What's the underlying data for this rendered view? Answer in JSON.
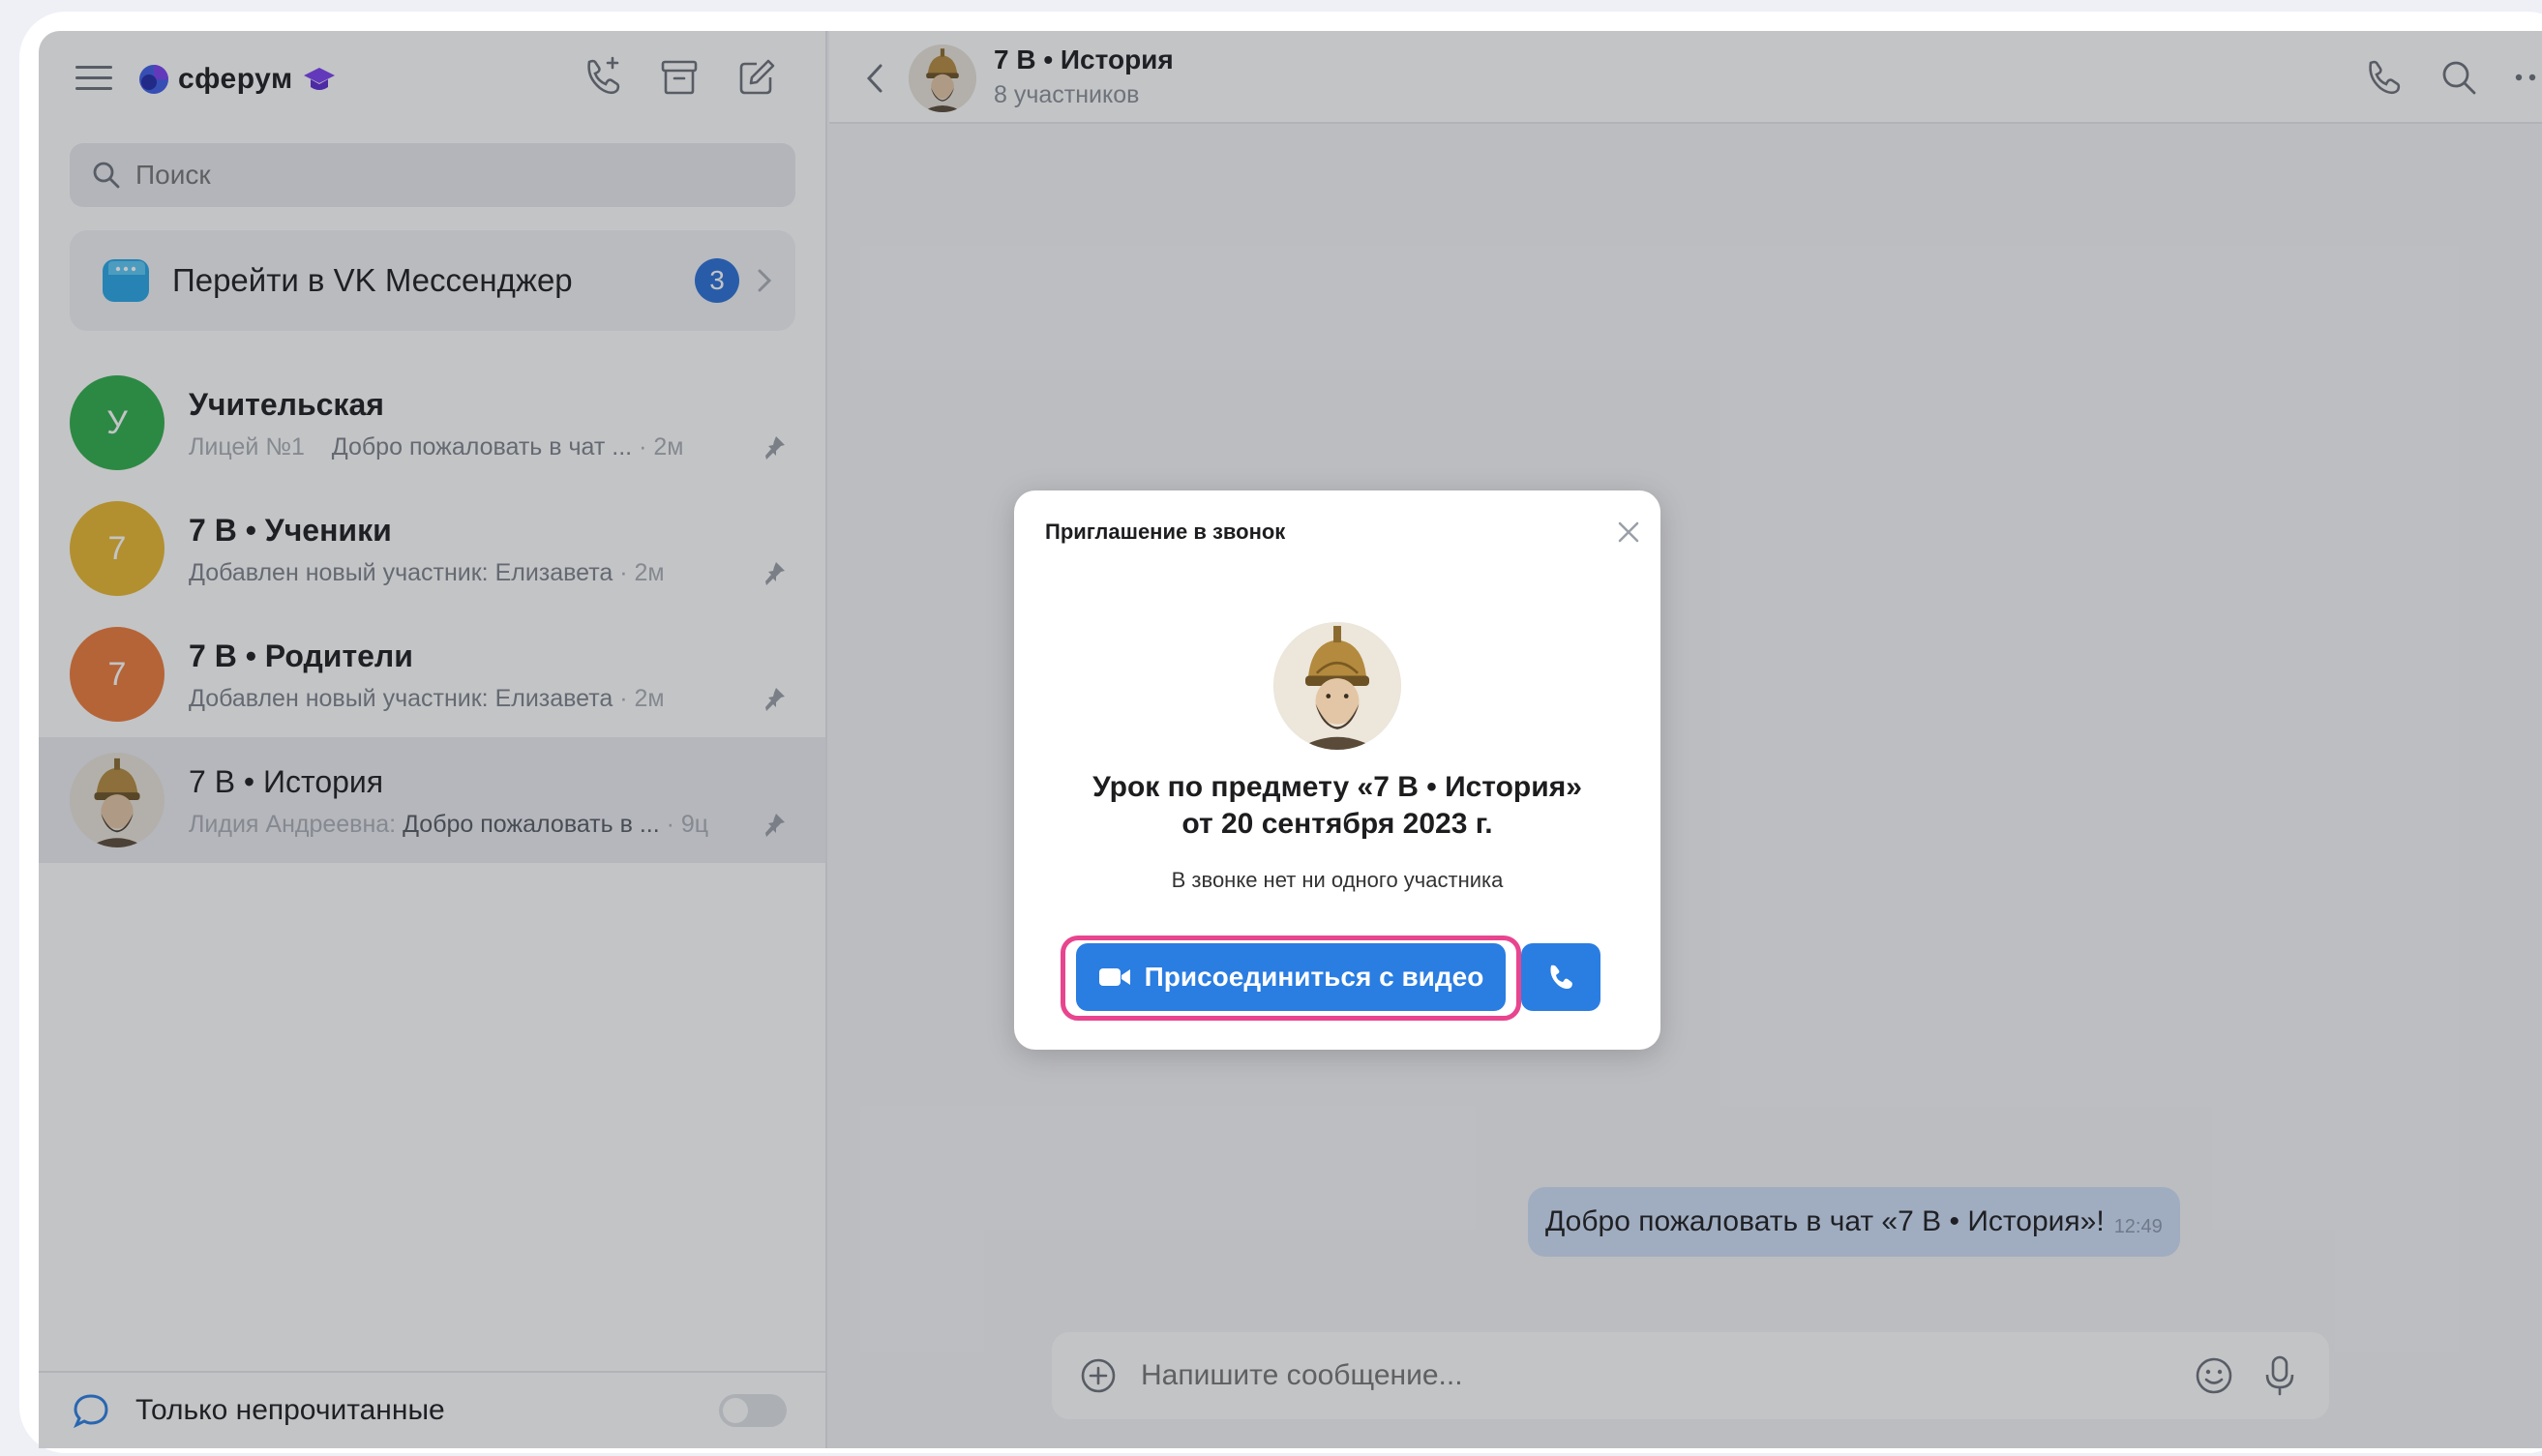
{
  "app": {
    "brand": "сферум"
  },
  "sidebar": {
    "search_placeholder": "Поиск",
    "vk_banner": {
      "label": "Перейти в VK Мессенджер",
      "count": "3"
    },
    "chats": [
      {
        "title": "Учительская",
        "avatar_letter": "У",
        "avatar_color": "#2fae4a",
        "sub_prefix": "Лицей №1",
        "sub_text": "Добро пожаловать в чат ...",
        "time": "2м"
      },
      {
        "title": "7 В • Ученики",
        "avatar_letter": "7",
        "avatar_color": "#e8b830",
        "sub_prefix": "",
        "sub_text": "Добавлен новый участник: Елизавета",
        "time": "2м"
      },
      {
        "title": "7 В • Родители",
        "avatar_letter": "7",
        "avatar_color": "#ec7b3a",
        "sub_prefix": "",
        "sub_text": "Добавлен новый участник: Елизавета",
        "time": "2м"
      },
      {
        "title": "7 В • История",
        "avatar_letter": "",
        "avatar_color": "#e9e4da",
        "sub_prefix": "Лидия Андреевна:",
        "sub_text": "Добро пожаловать в ...",
        "time": "9ц"
      }
    ],
    "footer_label": "Только непрочитанные"
  },
  "pane": {
    "title": "7 В • История",
    "subtitle": "8 участников",
    "message": {
      "text": "Добро пожаловать в чат «7 В • История»!",
      "time": "12:49"
    },
    "composer_placeholder": "Напишите сообщение..."
  },
  "modal": {
    "title": "Приглашение в звонок",
    "heading_line1": "Урок по предмету «7 В • История»",
    "heading_line2": "от 20 сентября 2023 г.",
    "status": "В звонке нет ни одного участника",
    "join_video_label": "Присоединиться с видео"
  },
  "colors": {
    "accent": "#2a7de1",
    "highlight": "#e8458f",
    "badge": "#2a6fd6"
  }
}
